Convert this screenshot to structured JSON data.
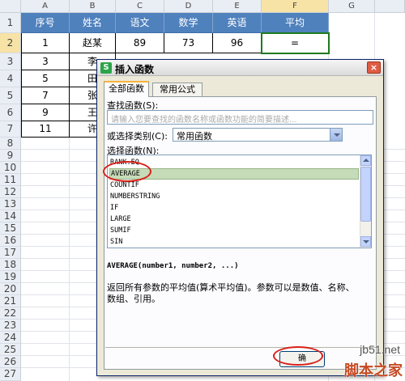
{
  "columns": [
    "A",
    "B",
    "C",
    "D",
    "E",
    "F",
    "G"
  ],
  "rows": [
    "1",
    "2",
    "3",
    "4",
    "5",
    "6",
    "7",
    "8",
    "9",
    "10",
    "11",
    "12",
    "13",
    "14",
    "15",
    "16",
    "17",
    "18",
    "19",
    "20",
    "21",
    "22",
    "23",
    "24",
    "25",
    "26",
    "27"
  ],
  "table": {
    "headers": [
      "序号",
      "姓名",
      "语文",
      "数学",
      "英语",
      "平均"
    ],
    "rows": [
      [
        "1",
        "赵某",
        "89",
        "73",
        "96",
        "="
      ],
      [
        "3",
        "李",
        "",
        "",
        "",
        ""
      ],
      [
        "5",
        "田",
        "",
        "",
        "",
        ""
      ],
      [
        "7",
        "张",
        "",
        "",
        "",
        ""
      ],
      [
        "9",
        "王",
        "",
        "",
        "",
        ""
      ],
      [
        "11",
        "许",
        "",
        "",
        "",
        ""
      ]
    ]
  },
  "dialog": {
    "title": "插入函数",
    "app_icon": "S",
    "close_label": "×",
    "tabs": [
      "全部函数",
      "常用公式"
    ],
    "search_label": "查找函数(S):",
    "search_placeholder": "请输入您要查找的函数名称或函数功能的简要描述...",
    "category_label": "或选择类别(C):",
    "category_value": "常用函数",
    "select_label": "选择函数(N):",
    "functions": [
      "RANK.EQ",
      "AVERAGE",
      "COUNTIF",
      "NUMBERSTRING",
      "IF",
      "LARGE",
      "SUMIF",
      "SIN"
    ],
    "selected_index": 1,
    "signature": "AVERAGE(number1, number2, ...)",
    "description": "返回所有参数的平均值(算术平均值)。参数可以是数值、名称、数组、引用。",
    "ok_label": "确"
  },
  "watermark": {
    "site": "jb51.net",
    "name": "脚本之家"
  }
}
